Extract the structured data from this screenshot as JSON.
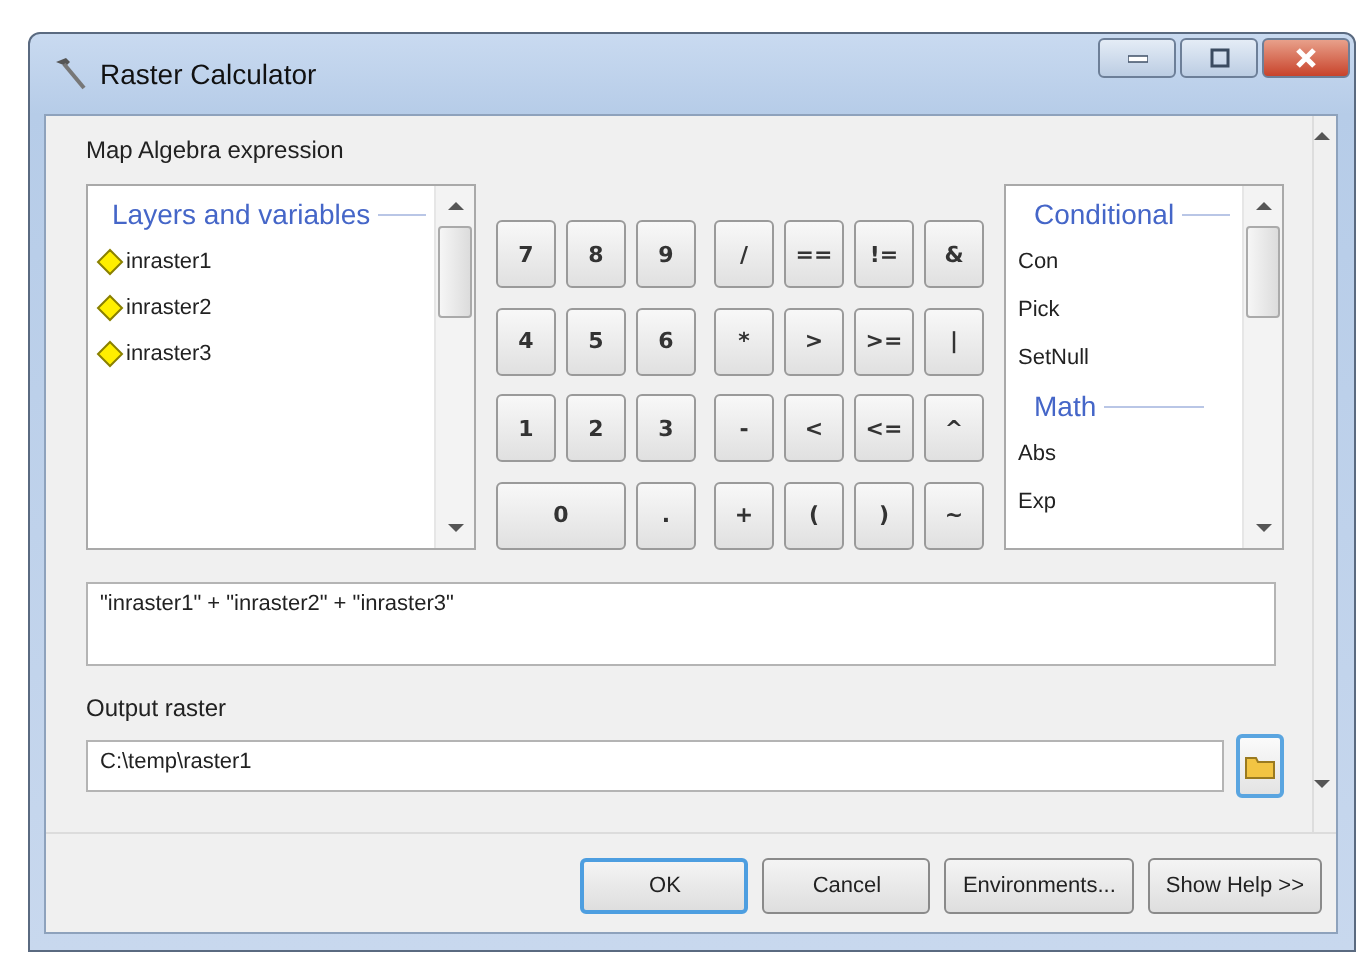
{
  "window": {
    "title": "Raster Calculator"
  },
  "expression_label": "Map Algebra expression",
  "layers": {
    "heading": "Layers and variables",
    "items": [
      "inraster1",
      "inraster2",
      "inraster3"
    ]
  },
  "keypad": {
    "digits": [
      [
        "7",
        "8",
        "9"
      ],
      [
        "4",
        "5",
        "6"
      ],
      [
        "1",
        "2",
        "3"
      ],
      [
        "0",
        "."
      ]
    ],
    "operators": [
      [
        "/",
        "==",
        "!=",
        "&"
      ],
      [
        "*",
        ">",
        ">=",
        "|"
      ],
      [
        "-",
        "<",
        "<=",
        "^"
      ],
      [
        "+",
        "(",
        ")",
        "~"
      ]
    ]
  },
  "functions": [
    {
      "heading": "Conditional",
      "items": [
        "Con",
        "Pick",
        "SetNull"
      ]
    },
    {
      "heading": "Math",
      "items": [
        "Abs",
        "Exp"
      ]
    }
  ],
  "expression": {
    "value": "\"inraster1\" + \"inraster2\" + \"inraster3\""
  },
  "output": {
    "label": "Output raster",
    "value": "C:\\temp\\raster1"
  },
  "buttons": [
    {
      "label": "OK",
      "default": true
    },
    {
      "label": "Cancel",
      "default": false
    },
    {
      "label": "Environments...",
      "default": false
    },
    {
      "label": "Show Help >>",
      "default": false
    }
  ]
}
